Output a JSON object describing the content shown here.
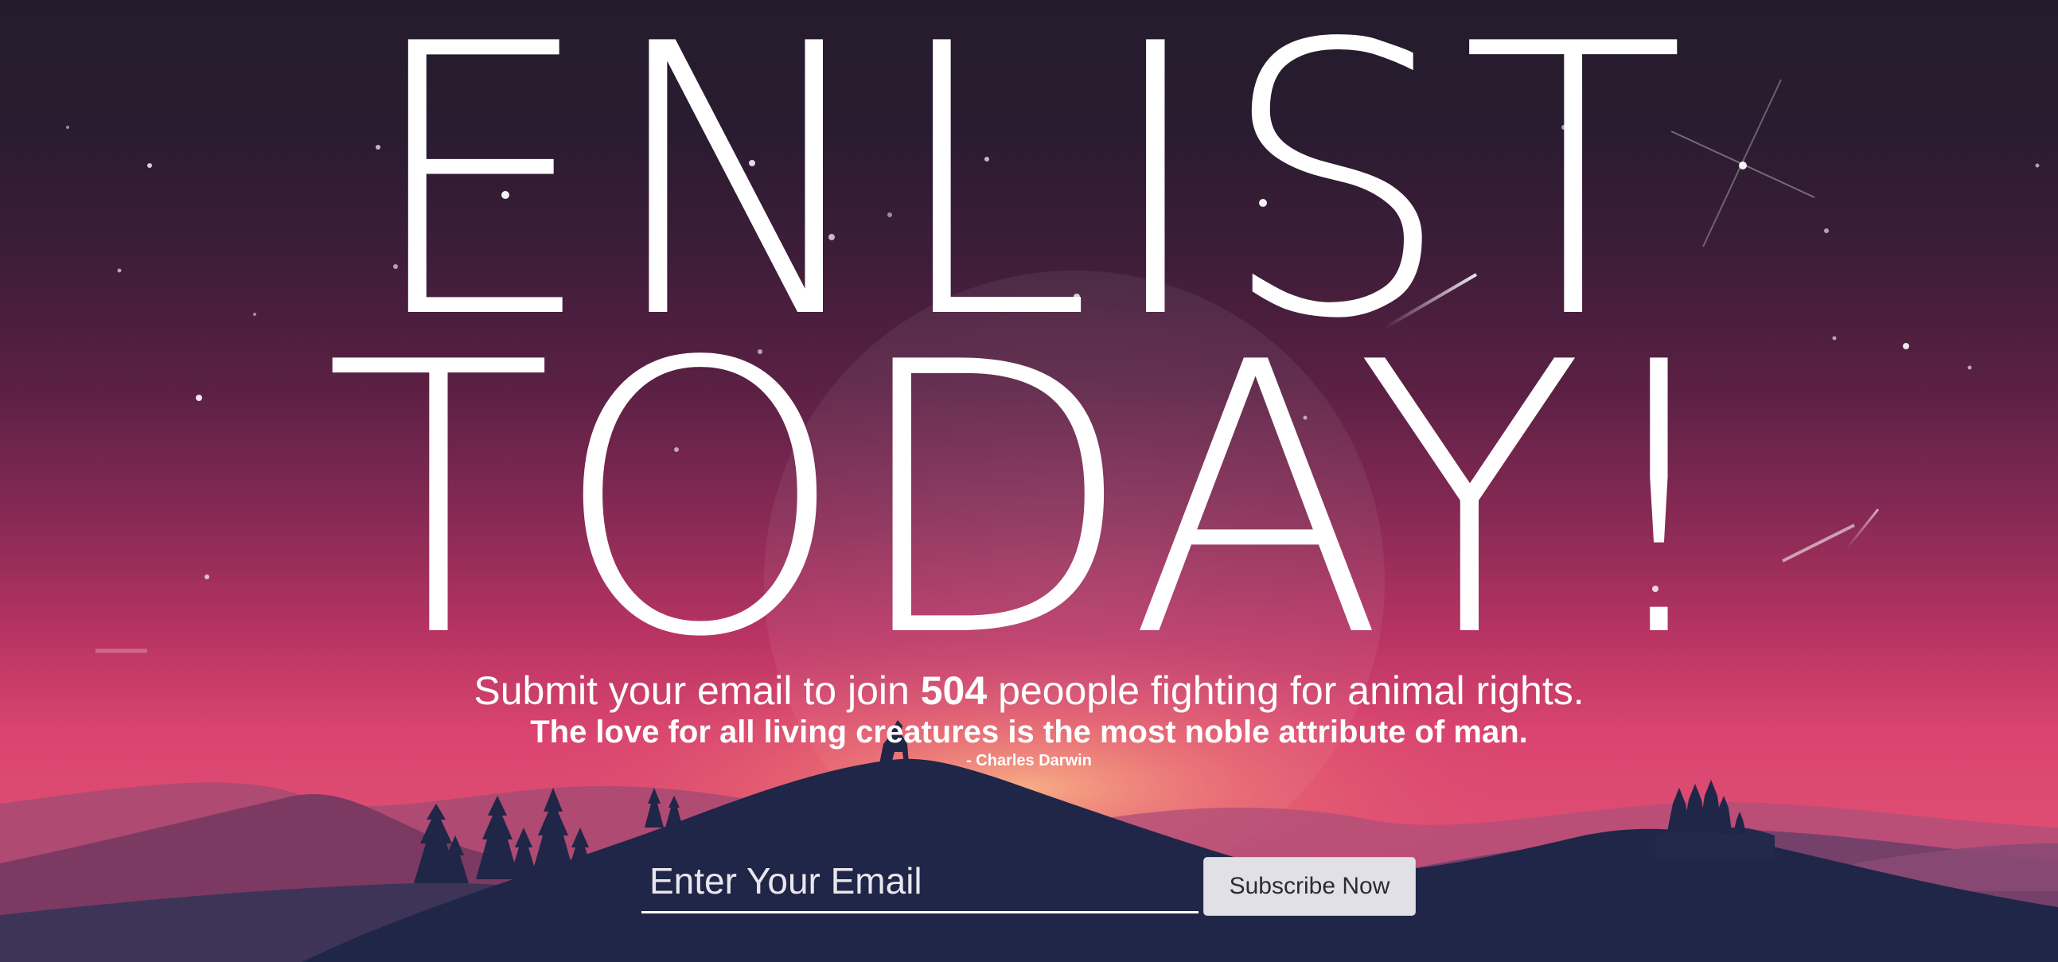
{
  "hero": {
    "headline_line_1": "ENLIST",
    "headline_line_2": "TODAY!",
    "subtitle_prefix": "Submit your email to join ",
    "member_count": "504",
    "subtitle_suffix": " peoople fighting for animal rights.",
    "quote": "The love for all living creatures is the most noble attribute of man.",
    "quote_author": "- Charles Darwin"
  },
  "form": {
    "email_placeholder": "Enter Your Email",
    "email_value": "",
    "submit_label": "Subscribe Now"
  },
  "colors": {
    "sky_top": "#241c2c",
    "sky_bottom": "#de4d73",
    "mountain_dark": "#1e2747",
    "button_bg": "#e0e0e6",
    "text": "#ffffff"
  }
}
